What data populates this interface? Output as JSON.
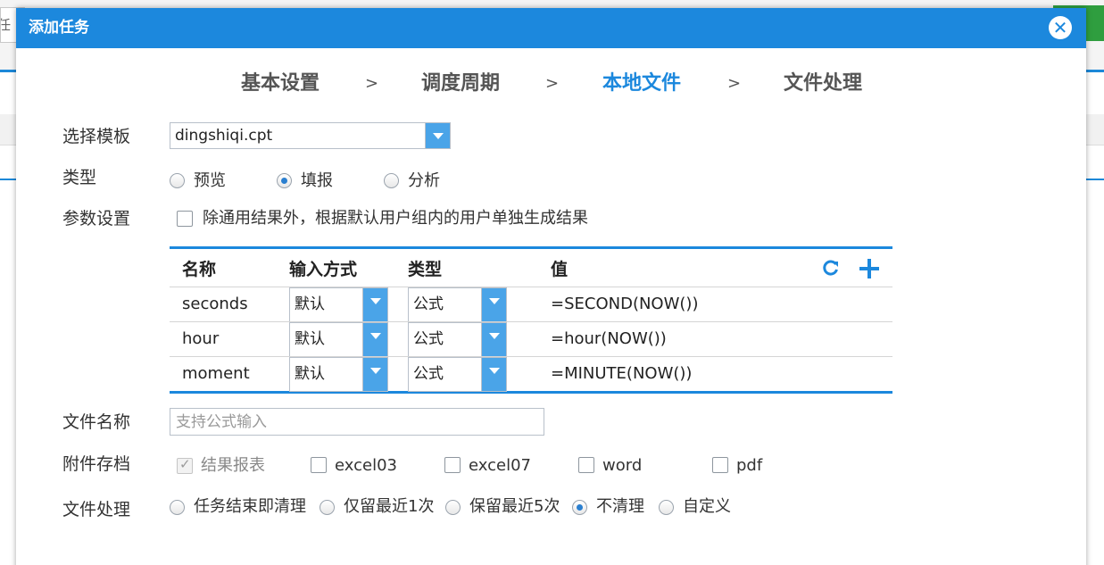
{
  "background": {
    "left_input_fragment": "任",
    "colors": {
      "header_blue": "#1c88dd",
      "search_green": "#2f9e3f"
    }
  },
  "dialog": {
    "title": "添加任务",
    "close_icon": "close-icon",
    "steps": [
      {
        "label": "基本设置"
      },
      {
        "label": "调度周期"
      },
      {
        "label": "本地文件"
      },
      {
        "label": "文件处理"
      }
    ],
    "step_separator": ">",
    "active_step": "本地文件",
    "template": {
      "label": "选择模板",
      "value": "dingshiqi.cpt"
    },
    "type": {
      "label": "类型",
      "options": [
        "预览",
        "填报",
        "分析"
      ],
      "selected": "填报"
    },
    "params": {
      "label": "参数设置",
      "checkbox_label": "除通用结果外，根据默认用户组内的用户单独生成结果",
      "checked": false,
      "columns": [
        "名称",
        "输入方式",
        "类型",
        "值"
      ],
      "rows": [
        {
          "name": "seconds",
          "input_mode": "默认",
          "type": "公式",
          "value": "=SECOND(NOW())"
        },
        {
          "name": "hour",
          "input_mode": "默认",
          "type": "公式",
          "value": "=hour(NOW())"
        },
        {
          "name": "moment",
          "input_mode": "默认",
          "type": "公式",
          "value": "=MINUTE(NOW())"
        }
      ]
    },
    "filename": {
      "label": "文件名称",
      "placeholder": "支持公式输入",
      "value": ""
    },
    "attachment": {
      "label": "附件存档",
      "options": [
        {
          "label": "结果报表",
          "checked": true,
          "disabled": true
        },
        {
          "label": "excel03",
          "checked": false
        },
        {
          "label": "excel07",
          "checked": false
        },
        {
          "label": "word",
          "checked": false
        },
        {
          "label": "pdf",
          "checked": false
        }
      ]
    },
    "file_handling": {
      "label": "文件处理",
      "options": [
        "任务结束即清理",
        "仅留最近1次",
        "保留最近5次",
        "不清理",
        "自定义"
      ],
      "selected": "不清理"
    }
  }
}
